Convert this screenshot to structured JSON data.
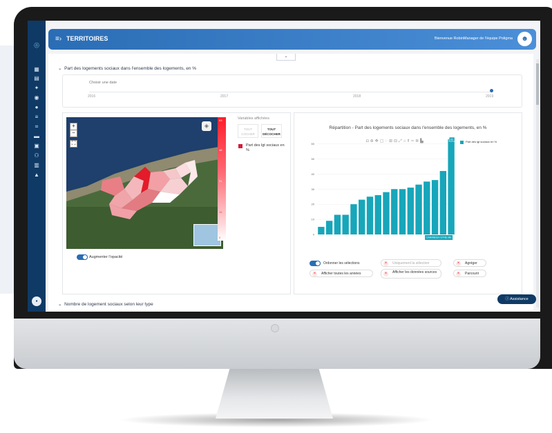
{
  "app": {
    "title": "TERRITOIRES",
    "welcome": "Bienvenue RobinManager de l'équipe Poligma"
  },
  "sidebar": {
    "icons": [
      "dashboard-icon",
      "table-icon",
      "pin-icon",
      "compass-icon",
      "globe-icon",
      "list-icon",
      "crop-icon",
      "chat-icon",
      "document-icon",
      "users-icon",
      "report-icon",
      "profile-icon"
    ]
  },
  "section1": {
    "title": "Part des logements sociaux dans l'ensemble des logements, en %"
  },
  "section2": {
    "title": "Nombre de logement sociaux selon leur type"
  },
  "timeline": {
    "label": "Choisir une date",
    "years": [
      "2016",
      "2017",
      "2018",
      "2019"
    ],
    "selected": "2019"
  },
  "map_panel": {
    "variables_title": "Variables affichées",
    "btn_select_all": "TOUT COCHER",
    "btn_deselect_all": "TOUT DÉCOCHER",
    "variable_label": "Part des lgt sociaux en %",
    "scale_labels": [
      "63",
      "48",
      "31",
      "16",
      "0"
    ],
    "opacity_label": "Augmenter l'opacité"
  },
  "chart_panel": {
    "title": "Répartition - Part des logements sociaux dans l'ensemble des logements, en %",
    "legend": "Part des lgt sociaux en %",
    "tooltip_category": "CARANEEV-SYNE ME",
    "tooltip_value": "63",
    "options": {
      "order_selection": "Ordonner les sélections",
      "only_selection": "Uniquement la sélection",
      "aggregate": "Agréger",
      "show_all_years": "Afficher toutes les années",
      "show_source_data": "Afficher les données sources",
      "browse": "Parcourir"
    }
  },
  "assistance": "Assistance",
  "colors": {
    "accent": "#2a6db5",
    "bar": "#17a6ba",
    "sidebar": "#0f3a66"
  },
  "chart_data": {
    "type": "bar",
    "title": "Répartition - Part des logements sociaux dans l'ensemble des logements, en %",
    "series": [
      {
        "name": "Part des lgt sociaux en %",
        "values": [
          5,
          9,
          13,
          13,
          20,
          23,
          25,
          26,
          28,
          30,
          30,
          31,
          33,
          35,
          36,
          42,
          63
        ]
      }
    ],
    "ylim": [
      0,
      63
    ],
    "yticks": [
      0,
      10,
      20,
      30,
      40,
      50,
      60
    ]
  }
}
